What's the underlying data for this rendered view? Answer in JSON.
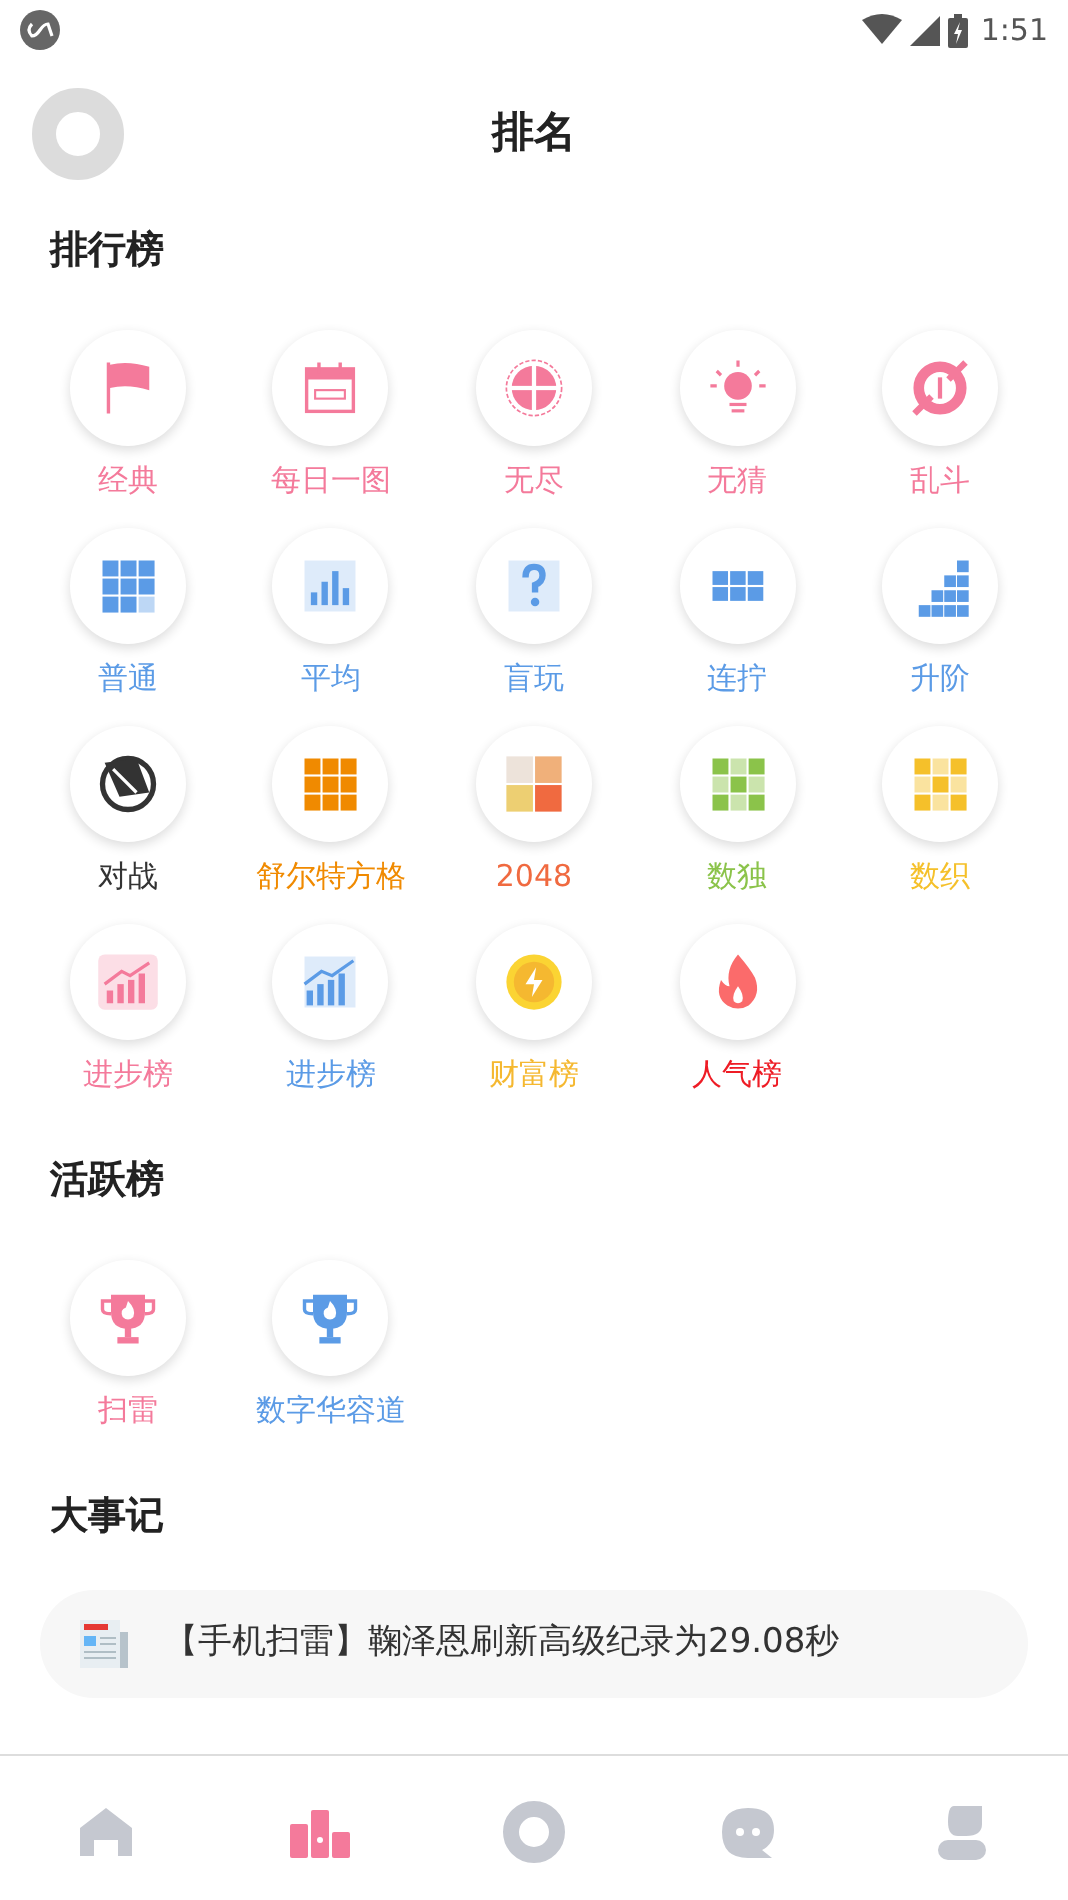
{
  "status_bar": {
    "time": "1:51"
  },
  "header": {
    "title": "排名"
  },
  "sections": [
    {
      "title": "排行榜",
      "items": [
        {
          "label": "经典",
          "kind": "flag",
          "color": "#f47a9b"
        },
        {
          "label": "每日一图",
          "kind": "calendar",
          "color": "#f47a9b"
        },
        {
          "label": "无尽",
          "kind": "target",
          "color": "#f47a9b"
        },
        {
          "label": "无猜",
          "kind": "bulb",
          "color": "#f47a9b"
        },
        {
          "label": "乱斗",
          "kind": "swirl",
          "color": "#f47a9b"
        },
        {
          "label": "普通",
          "kind": "grid",
          "color": "#5b9be6"
        },
        {
          "label": "平均",
          "kind": "bars",
          "color": "#5b9be6"
        },
        {
          "label": "盲玩",
          "kind": "question",
          "color": "#5b9be6"
        },
        {
          "label": "连拧",
          "kind": "chain",
          "color": "#5b9be6"
        },
        {
          "label": "升阶",
          "kind": "stairs",
          "color": "#5b9be6"
        },
        {
          "label": "对战",
          "kind": "blade",
          "color": "#333333"
        },
        {
          "label": "舒尔特方格",
          "kind": "grid",
          "color": "#f08a00"
        },
        {
          "label": "2048",
          "kind": "tiles",
          "color": "#f06a40"
        },
        {
          "label": "数独",
          "kind": "checker",
          "color": "#8bc34a"
        },
        {
          "label": "数织",
          "kind": "checker",
          "color": "#f5c02a"
        },
        {
          "label": "进步榜",
          "kind": "growth_card",
          "color": "#f47a9b"
        },
        {
          "label": "进步榜",
          "kind": "growth",
          "color": "#5b9be6"
        },
        {
          "label": "财富榜",
          "kind": "coin",
          "color": "#f5b830"
        },
        {
          "label": "人气榜",
          "kind": "flame",
          "color": "#ee1c25"
        }
      ]
    },
    {
      "title": "活跃榜",
      "items": [
        {
          "label": "扫雷",
          "kind": "trophy",
          "color": "#f47a9b"
        },
        {
          "label": "数字华容道",
          "kind": "trophy",
          "color": "#5b9be6"
        }
      ]
    }
  ],
  "events": {
    "title": "大事记",
    "items": [
      "【手机扫雷】鞠泽恩刷新高级纪录为29.08秒"
    ]
  },
  "bottom_nav": [
    {
      "kind": "home",
      "selected": false
    },
    {
      "kind": "podium",
      "selected": true
    },
    {
      "kind": "ring",
      "selected": false
    },
    {
      "kind": "chat",
      "selected": false
    },
    {
      "kind": "person",
      "selected": false
    }
  ]
}
